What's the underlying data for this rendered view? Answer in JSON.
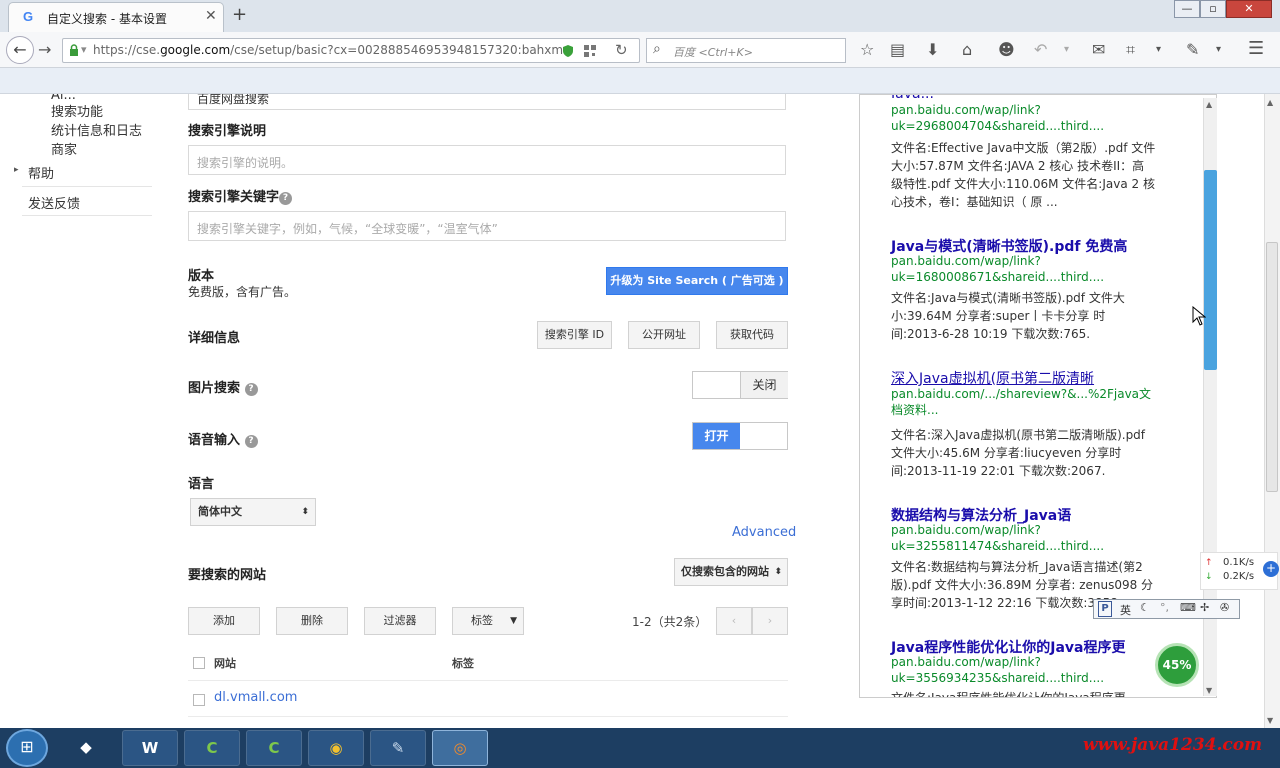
{
  "browser": {
    "tab_title": "自定义搜索 - 基本设置",
    "tab_favicon": "G",
    "new_tab": "+",
    "url_prefix": "https://cse.",
    "url_domain": "google.com",
    "url_rest": "/cse/setup/basic?cx=002888546953948157320:bahxm",
    "search_placeholder": "百度 <Ctrl+K>",
    "accent": "#4285f4"
  },
  "sidebar": {
    "items": [
      {
        "label": "搜索功能"
      },
      {
        "label": "统计信息和日志"
      },
      {
        "label": "商家"
      }
    ],
    "help": "帮助",
    "feedback": "发送反馈"
  },
  "form": {
    "engine_name_value": "百度网盘搜索",
    "description_label": "搜索引擎说明",
    "description_placeholder": "搜索引擎的说明。",
    "keywords_label": "搜索引擎关键字",
    "keywords_placeholder": "搜索引擎关键字，例如，气候，“全球变暖”，“温室气体”",
    "edition_label": "版本",
    "edition_value": "免费版，含有广告。",
    "upgrade_button": "升级为 Site Search ( 广告可选 )",
    "details_label": "详细信息",
    "engine_id_button": "搜索引擎 ID",
    "public_url_button": "公开网址",
    "get_code_button": "获取代码",
    "image_search_label": "图片搜索",
    "image_search_state": "关闭",
    "voice_input_label": "语音输入",
    "voice_input_state": "打开",
    "language_label": "语言",
    "language_value": "简体中文",
    "advanced_link": "Advanced",
    "sites_label": "要搜索的网站",
    "sites_mode": "仅搜索包含的网站",
    "add_button": "添加",
    "delete_button": "删除",
    "filter_button": "过滤器",
    "tag_button": "标签",
    "pagination": "1-2（共2条）",
    "col_site": "网站",
    "col_tag": "标签",
    "site_row_1": "dl.vmall.com"
  },
  "results": [
    {
      "url": "pan.baidu.com/wap/link?uk=2968004704&shareid....third....",
      "snippet_lines": [
        "文件名:Effective Java中文版（第2版）.pdf 文件",
        "大小:57.87M 文件名:JAVA 2 核心 技术卷II：高",
        "级特性.pdf 文件大小:110.06M 文件名:Java 2 核",
        "心技术，卷I：基础知识（ 原 ..."
      ]
    },
    {
      "title": "Java与模式(清晰书签版).pdf  免费高",
      "url": "pan.baidu.com/wap/link?uk=1680008671&shareid....third....",
      "snippet_lines": [
        "文件名:Java与模式(清晰书签版).pdf 文件大",
        "小:39.64M 分享者:super丨卡卡分享 时",
        "间:2013-6-28 10:19 下载次数:765."
      ]
    },
    {
      "title": "深入Java虚拟机(原书第二版清晰",
      "url": "pan.baidu.com/.../shareview?&...%2Fjava文档资料...",
      "snippet_lines": [
        "文件名:深入Java虚拟机(原书第二版清晰版).pdf",
        "文件大小:45.6M 分享者:liucyeven 分享时",
        "间:2013-11-19 22:01 下载次数:2067."
      ]
    },
    {
      "title": "数据结构与算法分析_Java语",
      "url": "pan.baidu.com/wap/link?uk=3255811474&shareid....third....",
      "snippet_lines": [
        "文件名:数据结构与算法分析_Java语言描述(第2",
        "版).pdf 文件大小:36.89M 分享者: zenus098 分",
        "享时间:2013-1-12 22:16 下载次数:3858."
      ]
    },
    {
      "title": "Java程序性能优化让你的Java程序更",
      "url": "pan.baidu.com/wap/link?uk=3556934235&shareid....third....",
      "snippet_lines": [
        "文件名:Java程序性能优化让你的Java程序更"
      ]
    }
  ],
  "ime": {
    "label": "英"
  },
  "net_monitor": {
    "percent": "45%",
    "up": "0.1K/s",
    "down": "0.2K/s"
  },
  "taskbar": {
    "watermark": "www.java1234.com"
  }
}
